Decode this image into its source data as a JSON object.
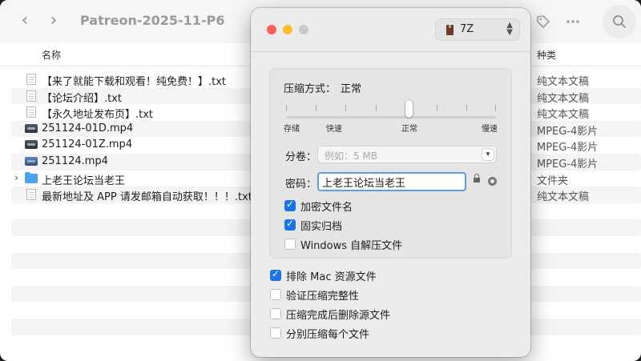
{
  "finder": {
    "title": "Patreon-2025-11-P6",
    "columns": {
      "name": "名称",
      "kind": "种类"
    },
    "files": [
      {
        "name": "【来了就能下载和观看！纯免费！】.txt",
        "kind": "纯文本文稿",
        "icon": "text-file-icon"
      },
      {
        "name": "【论坛介绍】.txt",
        "kind": "纯文本文稿",
        "icon": "text-file-icon"
      },
      {
        "name": "【永久地址发布页】.txt",
        "kind": "纯文本文稿",
        "icon": "text-file-icon"
      },
      {
        "name": "251124-01D.mp4",
        "kind": "MPEG-4影片",
        "icon": "video-file-icon"
      },
      {
        "name": "251124-01Z.mp4",
        "kind": "MPEG-4影片",
        "icon": "video-file-icon"
      },
      {
        "name": "251124.mp4",
        "kind": "MPEG-4影片",
        "icon": "video-file-icon"
      },
      {
        "name": "上老王论坛当老王",
        "kind": "文件夹",
        "icon": "folder-icon"
      },
      {
        "name": "最新地址及 APP 请发邮箱自动获取！！！.txt",
        "kind": "纯文本文稿",
        "icon": "text-file-icon"
      }
    ]
  },
  "dialog": {
    "format": {
      "value": "7Z"
    },
    "compression": {
      "label": "压缩方式：",
      "value": "正常",
      "levels": [
        "存储",
        "快速",
        "正常",
        "慢速"
      ],
      "selected_index": 2
    },
    "split": {
      "label": "分卷：",
      "placeholder": "例如：5 MB"
    },
    "password": {
      "label": "密码：",
      "value": "上老王论坛当老王"
    },
    "group_options": [
      {
        "label": "加密文件名",
        "checked": true
      },
      {
        "label": "固实归档",
        "checked": true
      },
      {
        "label": "Windows 自解压文件",
        "checked": false
      }
    ],
    "options": [
      {
        "label": "排除 Mac 资源文件",
        "checked": true
      },
      {
        "label": "验证压缩完整性",
        "checked": false
      },
      {
        "label": "压缩完成后删除源文件",
        "checked": false
      },
      {
        "label": "分别压缩每个文件",
        "checked": false
      }
    ],
    "colors": {
      "accent": "#1a73e8",
      "close": "#fe5f57",
      "minimize": "#febc2e",
      "zoom": "#c9c9c9"
    }
  }
}
